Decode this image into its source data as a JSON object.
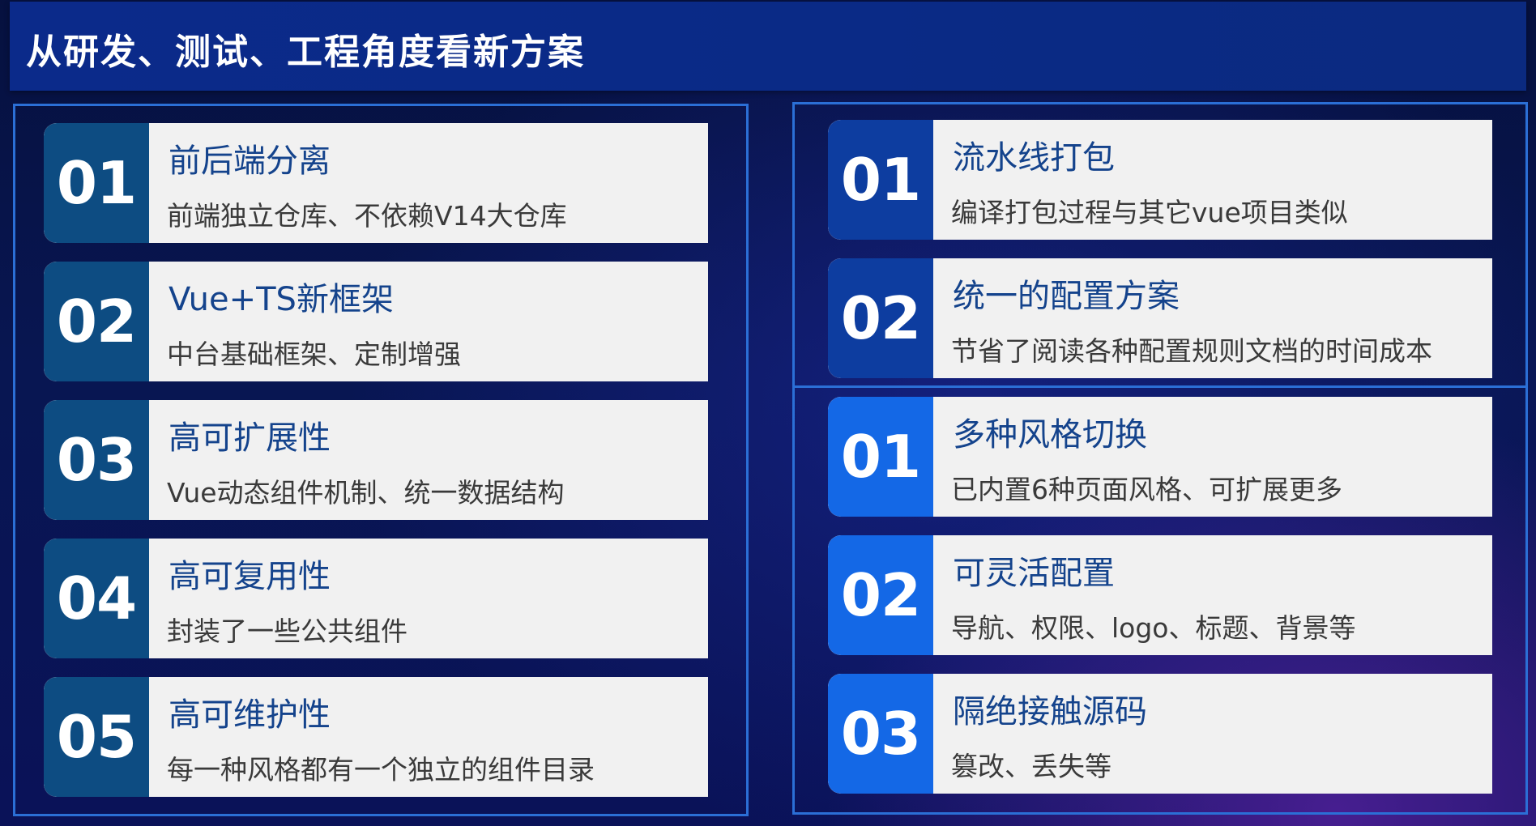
{
  "title": "从研发、测试、工程角度看新方案",
  "left_cards": [
    {
      "num": "01",
      "heading": "前后端分离",
      "desc": "前端独立仓库、不依赖V14大仓库"
    },
    {
      "num": "02",
      "heading": "Vue+TS新框架",
      "desc": "中台基础框架、定制增强"
    },
    {
      "num": "03",
      "heading": "高可扩展性",
      "desc": "Vue动态组件机制、统一数据结构"
    },
    {
      "num": "04",
      "heading": "高可复用性",
      "desc": "封装了一些公共组件"
    },
    {
      "num": "05",
      "heading": "高可维护性",
      "desc": "每一种风格都有一个独立的组件目录"
    }
  ],
  "right_top_cards": [
    {
      "num": "01",
      "heading": "流水线打包",
      "desc": "编译打包过程与其它vue项目类似"
    },
    {
      "num": "02",
      "heading": "统一的配置方案",
      "desc": "节省了阅读各种配置规则文档的时间成本"
    }
  ],
  "right_bottom_cards": [
    {
      "num": "01",
      "heading": "多种风格切换",
      "desc": "已内置6种页面风格、可扩展更多"
    },
    {
      "num": "02",
      "heading": "可灵活配置",
      "desc": "导航、权限、logo、标题、背景等"
    },
    {
      "num": "03",
      "heading": "隔绝接触源码",
      "desc": "篡改、丢失等"
    }
  ],
  "colors": {
    "title_bar": "#0b2a8a",
    "panel_border": "#2b6fd6",
    "num_left": "#0d4c82",
    "num_right_top": "#0d3da0",
    "num_right_bottom": "#1468e6",
    "heading_text": "#14438c",
    "card_bg": "#f1f1f1"
  }
}
